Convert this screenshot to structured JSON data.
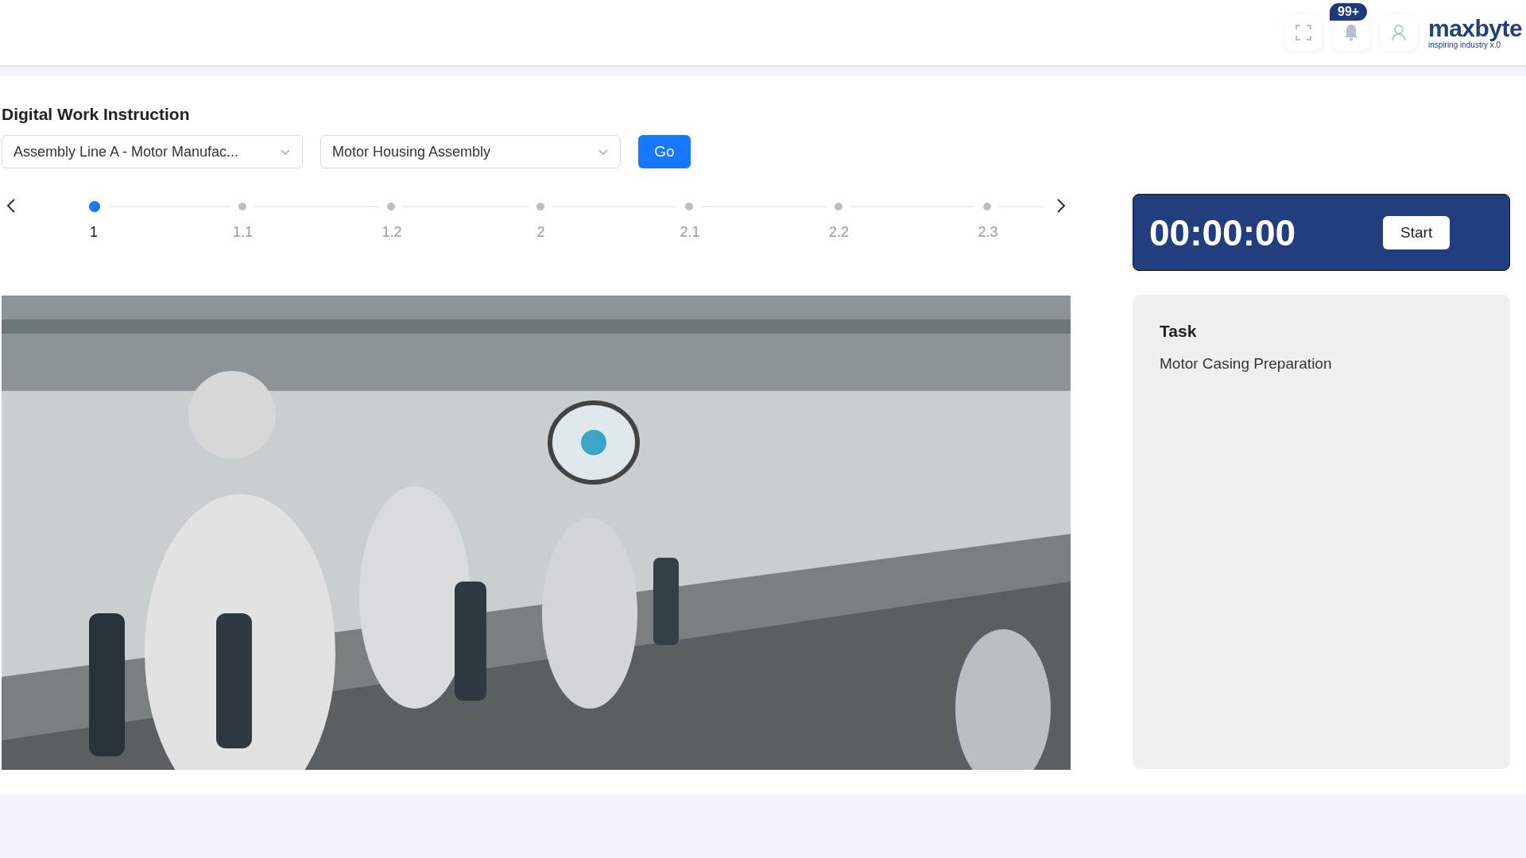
{
  "header": {
    "notifications": "99+",
    "logo": {
      "name": "maxbyte",
      "tagline": "inspiring industry x.0"
    }
  },
  "page": {
    "title": "Digital Work Instruction"
  },
  "selectors": [
    {
      "value": "Assembly Line A - Motor Manufac..."
    },
    {
      "value": "Motor Housing Assembly"
    }
  ],
  "go_button": "Go",
  "steps": [
    {
      "label": "1",
      "selected": true
    },
    {
      "label": "1.1",
      "selected": false
    },
    {
      "label": "1.2",
      "selected": false
    },
    {
      "label": "2",
      "selected": false
    },
    {
      "label": "2.1",
      "selected": false
    },
    {
      "label": "2.2",
      "selected": false
    },
    {
      "label": "2.3",
      "selected": false
    }
  ],
  "timer": {
    "time": "00:00:00",
    "button": "Start"
  },
  "task": {
    "heading": "Task",
    "text": "Motor Casing Preparation"
  }
}
